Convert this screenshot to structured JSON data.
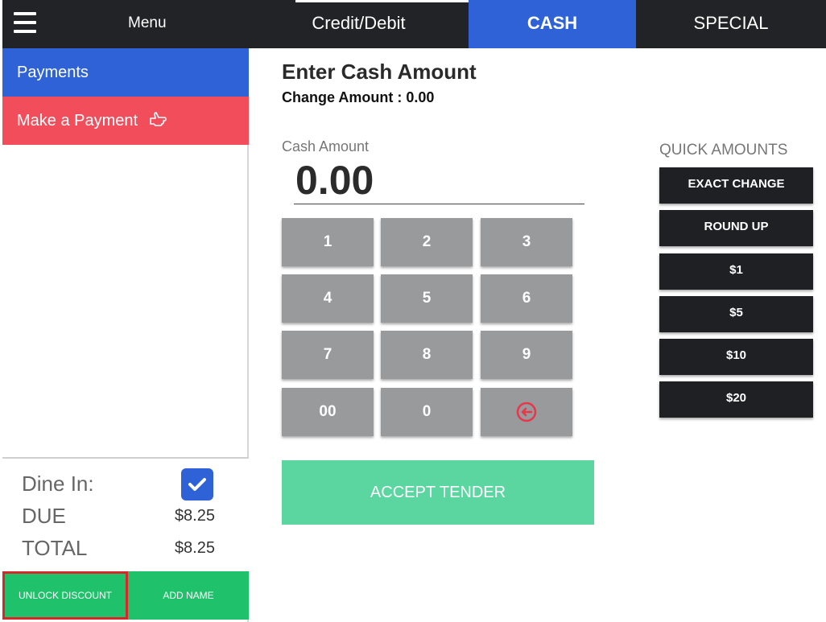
{
  "sidebar": {
    "menu_label": "Menu",
    "items": [
      {
        "label": "Payments"
      },
      {
        "label": "Make a Payment"
      }
    ],
    "summary": {
      "dine_in_label": "Dine In:",
      "dine_in_checked": true,
      "due_label": "DUE",
      "due_value": "$8.25",
      "total_label": "TOTAL",
      "total_value": "$8.25"
    },
    "footer": {
      "unlock_discount": "UNLOCK DISCOUNT",
      "add_name": "ADD NAME"
    }
  },
  "tabs": {
    "credit": "Credit/Debit",
    "cash": "CASH",
    "special": "SPECIAL",
    "active": "CASH"
  },
  "main": {
    "title": "Enter Cash Amount",
    "change_amount": "Change Amount : 0.00",
    "cash_label": "Cash Amount",
    "cash_value": "0.00",
    "keys": [
      "1",
      "2",
      "3",
      "4",
      "5",
      "6",
      "7",
      "8",
      "9",
      "00",
      "0"
    ],
    "backspace_icon": "backspace-icon",
    "accept": "ACCEPT TENDER"
  },
  "quick_amounts": {
    "title": "QUICK AMOUNTS",
    "buttons": [
      "EXACT CHANGE",
      "ROUND UP",
      "$1",
      "$5",
      "$10",
      "$20"
    ]
  },
  "colors": {
    "dark": "#222326",
    "blue": "#2f62d6",
    "red": "#f24d5b",
    "green": "#1fc26b",
    "accept_green": "#5bd6a0",
    "key_gray": "#999a9c",
    "backspace_red": "#e8364a"
  }
}
